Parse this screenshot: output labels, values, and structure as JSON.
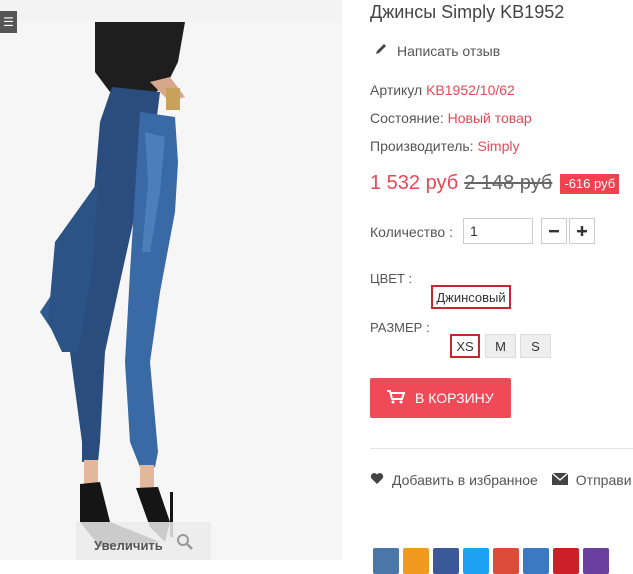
{
  "image": {
    "corner_label": "☰",
    "zoom_label": "Увеличить"
  },
  "product": {
    "title": "Джинсы Simply KB1952",
    "review_label": "Написать отзыв",
    "sku_label": "Артикул",
    "sku_value": "KB1952/10/62",
    "condition_label": "Состояние:",
    "condition_value": "Новый товар",
    "manufacturer_label": "Производитель:",
    "manufacturer_value": "Simply",
    "price": "1 532 руб",
    "old_price": "2 148 руб",
    "discount": "-616 руб"
  },
  "quantity": {
    "label": "Количество :",
    "value": "1",
    "minus": "−",
    "plus": "+"
  },
  "color": {
    "label": "ЦВЕТ :",
    "selected": "Джинсовый"
  },
  "size": {
    "label": "РАЗМЕР :",
    "options": [
      "XS",
      "M",
      "S"
    ],
    "selected": "XS"
  },
  "cart": {
    "label": "В КОРЗИНУ"
  },
  "actions": {
    "wishlist": "Добавить в избранное",
    "send": "Отправи"
  },
  "colors": {
    "accent": "#e84855",
    "cart_button": "#f04a59",
    "selected_border": "#c9252e"
  }
}
